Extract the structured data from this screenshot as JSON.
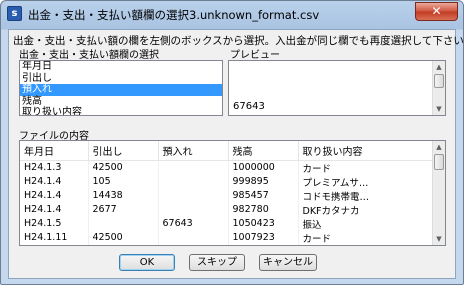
{
  "window": {
    "title": "出金・支出・支払い額欄の選択3.unknown_format.csv",
    "app_icon_letter": "s"
  },
  "instruction": "出金・支出・支払い額の欄を左側のボックスから選択。入出金が同じ欄でも再度選択して下さい。",
  "column_select_label": "出金・支出・支払い額欄の選択",
  "preview_label": "プレビュー",
  "columns_list": [
    {
      "label": "年月日",
      "selected": false
    },
    {
      "label": "引出し",
      "selected": false
    },
    {
      "label": "預入れ",
      "selected": true
    },
    {
      "label": "残高",
      "selected": false
    },
    {
      "label": "取り扱い内容",
      "selected": false
    }
  ],
  "preview_value": "67643",
  "file_contents_label": "ファイルの内容",
  "file_table": {
    "headers": [
      "年月日",
      "引出し",
      "預入れ",
      "残高",
      "取り扱い内容"
    ],
    "rows": [
      [
        "H24.1.3",
        "42500",
        "",
        "1000000",
        "カード"
      ],
      [
        "H24.1.4",
        "105",
        "",
        "999895",
        "プレミアムサ…"
      ],
      [
        "H24.1.4",
        "14438",
        "",
        "985457",
        "コドモ携帯電…"
      ],
      [
        "H24.1.4",
        "2677",
        "",
        "982780",
        "DKFカタナカ"
      ],
      [
        "H24.1.5",
        "",
        "67643",
        "1050423",
        "振込"
      ],
      [
        "H24.1.11",
        "42500",
        "",
        "1007923",
        "カード"
      ]
    ]
  },
  "buttons": {
    "ok": "OK",
    "skip": "スキップ",
    "cancel": "キャンセル"
  },
  "icons": {
    "close": "close-icon",
    "scroll_up": "scroll-up-icon",
    "scroll_down": "scroll-down-icon"
  }
}
